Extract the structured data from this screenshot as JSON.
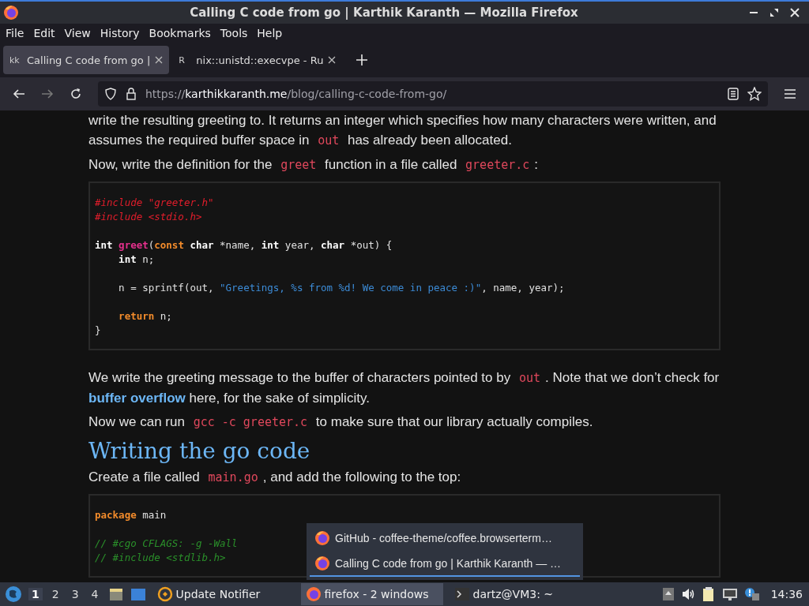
{
  "window": {
    "title": "Calling C code from go | Karthik Karanth — Mozilla Firefox"
  },
  "menu": [
    {
      "label": "File"
    },
    {
      "label": "Edit"
    },
    {
      "label": "View"
    },
    {
      "label": "History"
    },
    {
      "label": "Bookmarks"
    },
    {
      "label": "Tools"
    },
    {
      "label": "Help"
    }
  ],
  "tabs": [
    {
      "favicon": "kk",
      "title": "Calling C code from go |",
      "selected": true
    },
    {
      "favicon": "R",
      "title": "nix::unistd::execvpe - Ru",
      "selected": false
    }
  ],
  "address": {
    "scheme": "https://",
    "domain": "karthikkaranth.me",
    "path": "/blog/calling-c-code-from-go/"
  },
  "article": [
    {
      "kind": "para",
      "segments": [
        {
          "kind": "text",
          "text": "write the resulting greeting to. It returns an integer which specifies how many characters were written, and assumes the required buffer space in "
        },
        {
          "kind": "code",
          "text": "out"
        },
        {
          "kind": "text",
          "text": " has already been allocated."
        }
      ]
    },
    {
      "kind": "para",
      "segments": [
        {
          "kind": "text",
          "text": "Now, write the definition for the "
        },
        {
          "kind": "code",
          "text": "greet"
        },
        {
          "kind": "text",
          "text": " function in a file called "
        },
        {
          "kind": "code",
          "text": "greeter.c"
        },
        {
          "kind": "text",
          "text": ":"
        }
      ]
    },
    {
      "kind": "code",
      "lines": [
        {
          "kind": "line",
          "tokens": [
            {
              "kind": "pre",
              "text": "#include \"greeter.h\""
            }
          ]
        },
        {
          "kind": "line",
          "tokens": [
            {
              "kind": "pre",
              "text": "#include <stdio.h>"
            }
          ]
        },
        {
          "kind": "blank"
        },
        {
          "kind": "line",
          "tokens": [
            {
              "kind": "kw",
              "text": "int "
            },
            {
              "kind": "fn",
              "text": "greet"
            },
            {
              "kind": "plain",
              "text": "("
            },
            {
              "kind": "kw2",
              "text": "const "
            },
            {
              "kind": "kw",
              "text": "char"
            },
            {
              "kind": "plain",
              "text": " *name, "
            },
            {
              "kind": "kw",
              "text": "int"
            },
            {
              "kind": "plain",
              "text": " year, "
            },
            {
              "kind": "kw",
              "text": "char"
            },
            {
              "kind": "plain",
              "text": " *out) {"
            }
          ]
        },
        {
          "kind": "line",
          "tokens": [
            {
              "kind": "kw",
              "text": "    int"
            },
            {
              "kind": "plain",
              "text": " n;"
            }
          ]
        },
        {
          "kind": "blank"
        },
        {
          "kind": "line",
          "tokens": [
            {
              "kind": "plain",
              "text": "    n = sprintf(out, "
            },
            {
              "kind": "str",
              "text": "\"Greetings, %s from %d! We come in peace :)\""
            },
            {
              "kind": "plain",
              "text": ", name, year);"
            }
          ]
        },
        {
          "kind": "blank"
        },
        {
          "kind": "line",
          "tokens": [
            {
              "kind": "kw2",
              "text": "    return"
            },
            {
              "kind": "plain",
              "text": " n;"
            }
          ]
        },
        {
          "kind": "line",
          "tokens": [
            {
              "kind": "plain",
              "text": "}"
            }
          ]
        }
      ]
    },
    {
      "kind": "para",
      "segments": [
        {
          "kind": "text",
          "text": "We write the greeting message to the buffer of characters pointed to by "
        },
        {
          "kind": "code",
          "text": "out"
        },
        {
          "kind": "text",
          "text": ". Note that we don’t check for "
        },
        {
          "kind": "link",
          "text": "buffer overflow"
        },
        {
          "kind": "text",
          "text": " here, for the sake of simplicity."
        }
      ]
    },
    {
      "kind": "para",
      "segments": [
        {
          "kind": "text",
          "text": "Now we can run "
        },
        {
          "kind": "code",
          "text": "gcc -c greeter.c"
        },
        {
          "kind": "text",
          "text": " to make sure that our library actually compiles."
        }
      ]
    },
    {
      "kind": "heading",
      "text": "Writing the go code"
    },
    {
      "kind": "para",
      "segments": [
        {
          "kind": "text",
          "text": "Create a file called "
        },
        {
          "kind": "code",
          "text": "main.go"
        },
        {
          "kind": "text",
          "text": ", and add the following to the top:"
        }
      ]
    },
    {
      "kind": "code",
      "lines": [
        {
          "kind": "line",
          "tokens": [
            {
              "kind": "kw2",
              "text": "package"
            },
            {
              "kind": "plain",
              "text": " main"
            }
          ]
        },
        {
          "kind": "blank"
        },
        {
          "kind": "line",
          "tokens": [
            {
              "kind": "cm",
              "text": "// #cgo CFLAGS: -g -Wall"
            }
          ]
        },
        {
          "kind": "line",
          "tokens": [
            {
              "kind": "cm",
              "text": "// #include <stdlib.h>"
            }
          ]
        }
      ]
    }
  ],
  "popup": [
    {
      "title": "GitHub - coffee-theme/coffee.browserterm…",
      "selected": false
    },
    {
      "title": "Calling C code from go | Karthik Karanth — …",
      "selected": true
    }
  ],
  "taskbar": {
    "workspaces": [
      {
        "label": "1",
        "selected": true
      },
      {
        "label": "2",
        "selected": false
      },
      {
        "label": "3",
        "selected": false
      },
      {
        "label": "4",
        "selected": false
      }
    ],
    "tasks": [
      {
        "kind": "updater",
        "label": "Update Notifier",
        "selected": false
      },
      {
        "kind": "firefox",
        "label": "firefox - 2 windows",
        "selected": true
      },
      {
        "kind": "terminal",
        "label": "dartz@VM3: ~",
        "selected": false
      }
    ],
    "clock": "14:36"
  }
}
